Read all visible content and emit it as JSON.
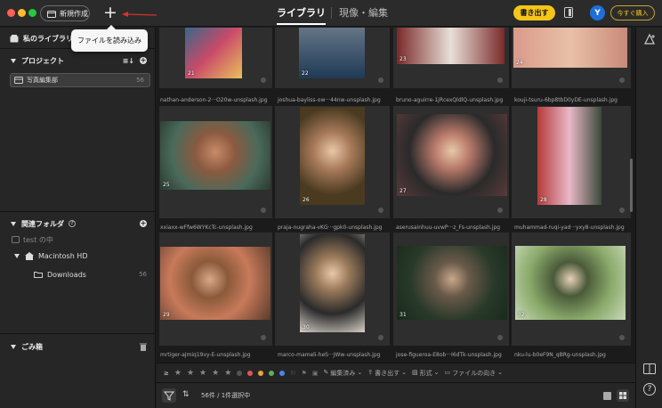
{
  "titlebar": {
    "new_button_label": "新規作成",
    "tooltip": "ファイルを読み込み",
    "tab_library": "ライブラリ",
    "tab_develop": "現像・編集",
    "export_label": "書き出す",
    "avatar_initial": "Y",
    "buy_label": "今すぐ購入"
  },
  "sidebar": {
    "my_library": "私のライブラリ",
    "projects_title": "プロジェクト",
    "project_item": {
      "label": "写真編集部",
      "count": "56"
    },
    "folders_title": "関連フォルダ",
    "folder_hint": "test の中",
    "macintosh": "Macintosh HD",
    "downloads": {
      "label": "Downloads",
      "count": "56"
    },
    "trash_title": "ごみ箱"
  },
  "grid": {
    "rows": [
      {
        "numbers": [
          "21",
          "22",
          "23",
          "24"
        ],
        "names": [
          "nathan-anderson-2···O20w-unsplash.jpg",
          "joshua-bayliss-ow···44nw-unsplash.jpg",
          "bruno-aguirre-1jRcexQldlQ-unsplash.jpg",
          "kouji-tsuru-6bp8tbD0yDE-unsplash.jpg"
        ]
      },
      {
        "numbers": [
          "25",
          "26",
          "27",
          "28"
        ],
        "names": [
          "xxiaxx-wFfw6WYKcTc-unsplash.jpg",
          "praja-nugraha-vKG···gpk0-unsplash.jpg",
          "aserusainhuu-uvwP···z_Fs-unsplash.jpg",
          "muhammad-ruqi-yad···yxy8-unsplash.jpg"
        ]
      },
      {
        "numbers": [
          "29",
          "30",
          "31",
          "32"
        ],
        "names": [
          "mrtiger-aJmiq19vy-E-unsplash.jpg",
          "marco-mameli-heS···JWw-unsplash.jpg",
          "jose-figueroa-E8ob···I6dTk-unsplash.jpg",
          "nku-lu-b0eF9N_qBRg-unsplash.jpg"
        ]
      }
    ]
  },
  "toolbar": {
    "edited": "編集済み",
    "export": "書き出す",
    "format": "形式",
    "orientation": "ファイルの向き"
  },
  "status": {
    "text": "56件 / 1件選択中"
  },
  "colors": {
    "accent": "#f5c518",
    "avatar": "#1e6fd9",
    "label_colors": [
      "#e25555",
      "#e8a33a",
      "#d6cf3a",
      "#5fae5a",
      "#4a86e8"
    ]
  }
}
